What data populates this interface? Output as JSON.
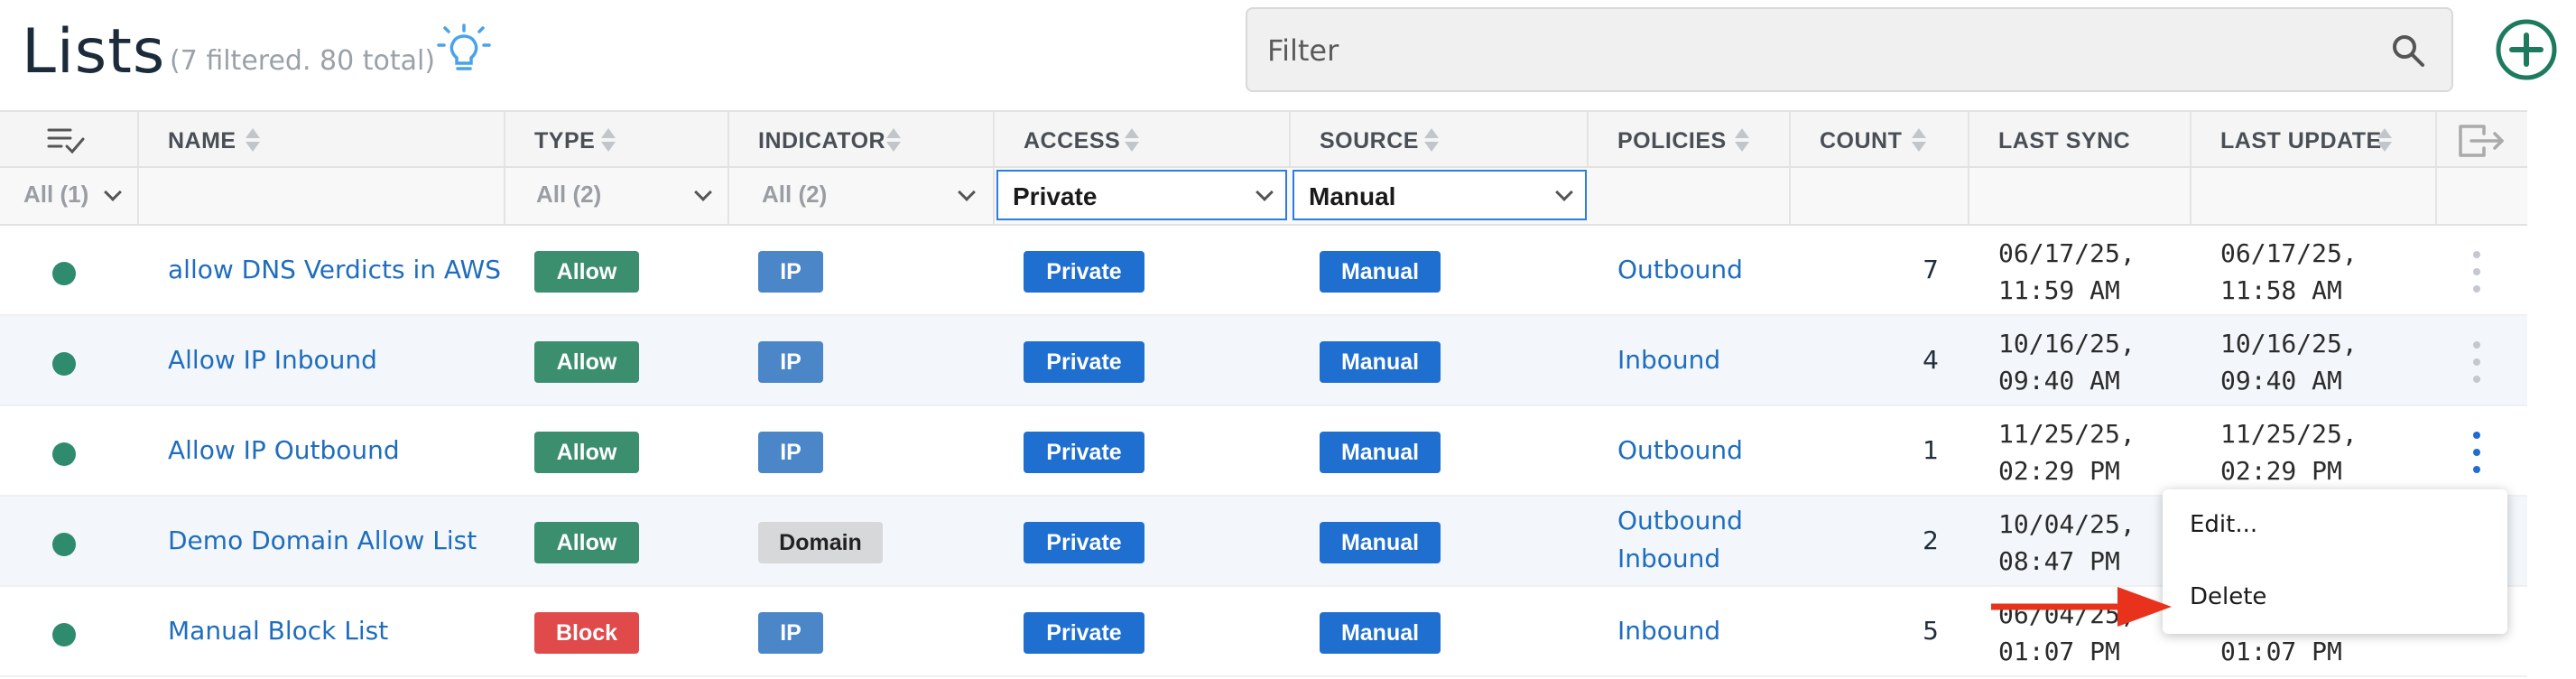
{
  "header": {
    "title": "Lists",
    "subtitle": "(7 filtered. 80 total)",
    "filter_placeholder": "Filter"
  },
  "columns": {
    "name": "NAME",
    "type": "TYPE",
    "indicator": "INDICATOR",
    "access": "ACCESS",
    "source": "SOURCE",
    "policies": "POLICIES",
    "count": "COUNT",
    "last_sync": "LAST SYNC",
    "last_update": "LAST UPDATE"
  },
  "filters": {
    "status": "All (1)",
    "type": "All (2)",
    "indicator": "All (2)",
    "access": "Private",
    "source": "Manual"
  },
  "rows": [
    {
      "name": "allow DNS Verdicts in AWS",
      "type": "Allow",
      "indicator": "IP",
      "access": "Private",
      "source": "Manual",
      "policies": "Outbound",
      "policies2": "",
      "count": "7",
      "last_sync": "06/17/25,\n11:59 AM",
      "last_update": "06/17/25,\n11:58 AM"
    },
    {
      "name": "Allow IP Inbound",
      "type": "Allow",
      "indicator": "IP",
      "access": "Private",
      "source": "Manual",
      "policies": "Inbound",
      "policies2": "",
      "count": "4",
      "last_sync": "10/16/25,\n09:40 AM",
      "last_update": "10/16/25,\n09:40 AM"
    },
    {
      "name": "Allow IP Outbound",
      "type": "Allow",
      "indicator": "IP",
      "access": "Private",
      "source": "Manual",
      "policies": "Outbound",
      "policies2": "",
      "count": "1",
      "last_sync": "11/25/25,\n02:29 PM",
      "last_update": "11/25/25,\n02:29 PM"
    },
    {
      "name": "Demo Domain Allow List",
      "type": "Allow",
      "indicator": "Domain",
      "access": "Private",
      "source": "Manual",
      "policies": "Outbound",
      "policies2": "Inbound",
      "count": "2",
      "last_sync": "10/04/25,\n08:47 PM",
      "last_update": ""
    },
    {
      "name": "Manual Block List",
      "type": "Block",
      "indicator": "IP",
      "access": "Private",
      "source": "Manual",
      "policies": "Inbound",
      "policies2": "",
      "count": "5",
      "last_sync": "06/04/25,\n01:07 PM",
      "last_update": "01:07 PM"
    }
  ],
  "menu": {
    "edit": "Edit...",
    "delete": "Delete"
  },
  "colors": {
    "accent": "#1f6fd1",
    "allow": "#3b8f6f",
    "block": "#e04a4a",
    "status_active": "#2e8b6e",
    "annotation_arrow": "#e8321c"
  },
  "icons": {
    "bulb": "lightbulb-icon",
    "search": "search-icon",
    "add": "plus-circle-icon",
    "select_all": "list-check-icon",
    "export": "export-icon",
    "row_menu": "kebab-icon"
  }
}
